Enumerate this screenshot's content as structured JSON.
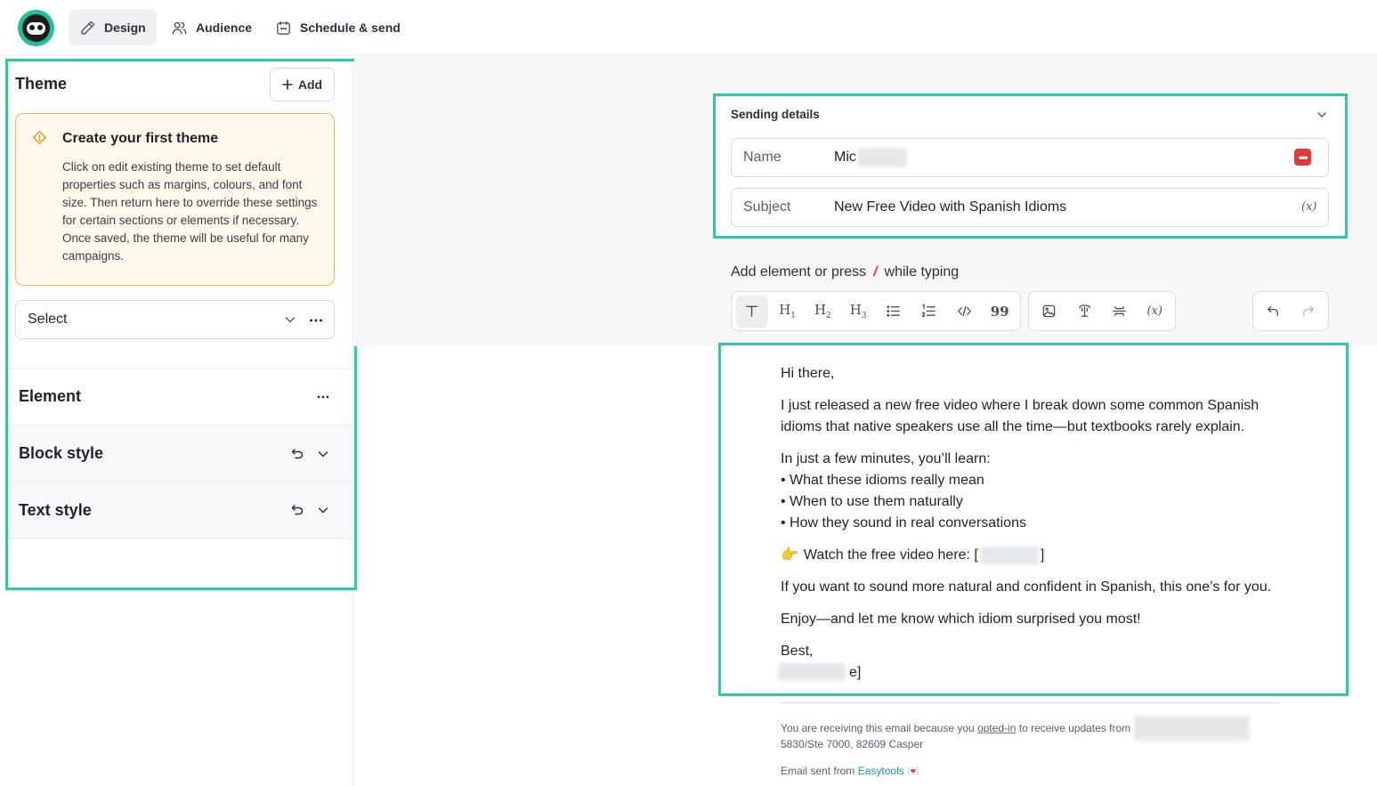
{
  "nav": {
    "tabs": [
      {
        "label": "Design",
        "icon": "pencil-icon",
        "active": true
      },
      {
        "label": "Audience",
        "icon": "users-icon",
        "active": false
      },
      {
        "label": "Schedule & send",
        "icon": "calendar-icon",
        "active": false
      }
    ]
  },
  "theme": {
    "title": "Theme",
    "add_label": "Add",
    "notice_title": "Create your first theme",
    "notice_body": "Click on edit existing theme to set default properties such as margins, colours, and font size. Then return here to override these settings for certain sections or elements if necessary. Once saved, the theme will be useful for many campaigns.",
    "select_label": "Select"
  },
  "sections": {
    "element": "Element",
    "block_style": "Block style",
    "text_style": "Text style"
  },
  "sending": {
    "title": "Sending details",
    "name_label": "Name",
    "name_value": "Mic",
    "subject_label": "Subject",
    "subject_value": "New Free Video with Spanish Idioms",
    "variable_icon_text": "(x)"
  },
  "editor": {
    "hint_before": "Add element or press",
    "hint_key": "/",
    "hint_after": "while typing"
  },
  "email": {
    "greeting": "Hi there,",
    "para1_line1": "I just released a new free video where I break down some common Spanish",
    "para1_line2": "idioms that native speakers use all the time—but textbooks rarely explain.",
    "para2_intro": "In just a few minutes, you’ll learn:",
    "bullets": [
      "• What these idioms really mean",
      "• When to use them naturally",
      "• How they sound in real conversations"
    ],
    "watch_emoji": "👉",
    "watch_text": "Watch the free video here: [",
    "watch_end": "]",
    "para4": "If you want to sound more natural and confident in Spanish, this one’s for you.",
    "para5": "Enjoy—and let me know which idiom surprised you most!",
    "signoff": "Best,",
    "signature_end": "e]"
  },
  "footer": {
    "line1_before": "You are receiving this email because you",
    "optin": "opted-in",
    "line1_after": "to receive updates from",
    "line2": "5830/Ste 7000, 82609 Casper",
    "sent_from": "Email sent from",
    "brand": "Easytools",
    "heart": "💌"
  },
  "colors": {
    "accent": "#2ccca3",
    "brand_green": "#1fbf9a",
    "notice_border": "#f2b64b",
    "notice_bg": "#fff8ec",
    "danger": "#e03b3b"
  }
}
